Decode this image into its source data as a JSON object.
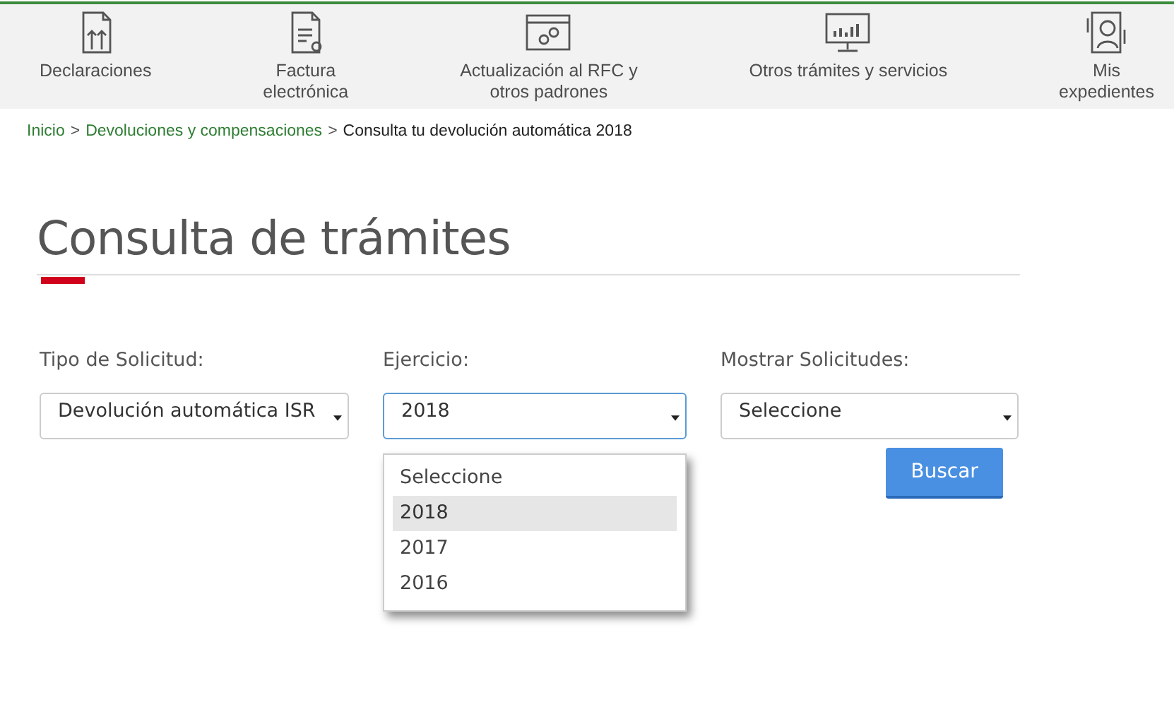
{
  "nav": [
    {
      "lines": [
        "Declaraciones"
      ]
    },
    {
      "lines": [
        "Factura",
        "electrónica"
      ]
    },
    {
      "lines": [
        "Actualización al RFC y",
        "otros padrones"
      ]
    },
    {
      "lines": [
        "Otros trámites y servicios"
      ]
    },
    {
      "lines": [
        "Mis",
        "expedientes"
      ]
    }
  ],
  "breadcrumb": {
    "links": [
      "Inicio",
      "Devoluciones y compensaciones"
    ],
    "separator": ">",
    "current": "Consulta tu devolución automática 2018"
  },
  "title": "Consulta de trámites",
  "filters": [
    {
      "label": "Tipo de Solicitud:",
      "value": "Devolución automática ISR",
      "focused": false
    },
    {
      "label": "Ejercicio:",
      "value": "2018",
      "focused": true,
      "expanded": true,
      "options": [
        {
          "label": "Seleccione",
          "selected": false
        },
        {
          "label": "2018",
          "selected": true
        },
        {
          "label": "2017",
          "selected": false
        },
        {
          "label": "2016",
          "selected": false
        }
      ]
    },
    {
      "label": "Mostrar Solicitudes:",
      "value": "Seleccione",
      "focused": false
    }
  ],
  "search_button": "Buscar"
}
